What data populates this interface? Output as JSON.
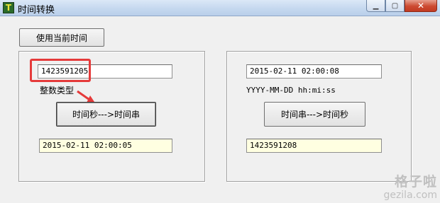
{
  "window": {
    "title": "时间转换",
    "app_icon_glyph": "T",
    "minimize_glyph": "▁",
    "maximize_glyph": "▢",
    "close_glyph": "✕"
  },
  "toolbar": {
    "current_time_label": "使用当前时间"
  },
  "left_panel": {
    "seconds_value": "1423591205",
    "type_label": "整数类型",
    "convert_label": "时间秒--->时间串",
    "result_value": "2015-02-11 02:00:05"
  },
  "right_panel": {
    "time_string_value": "2015-02-11 02:00:08",
    "format_hint": "YYYY-MM-DD hh:mi:ss",
    "convert_label": "时间串--->时间秒",
    "result_value": "1423591208"
  },
  "annotation": {
    "color": "#e53a3a"
  },
  "watermark": {
    "text_cn": "格子啦",
    "text_url": "gezila.com"
  }
}
